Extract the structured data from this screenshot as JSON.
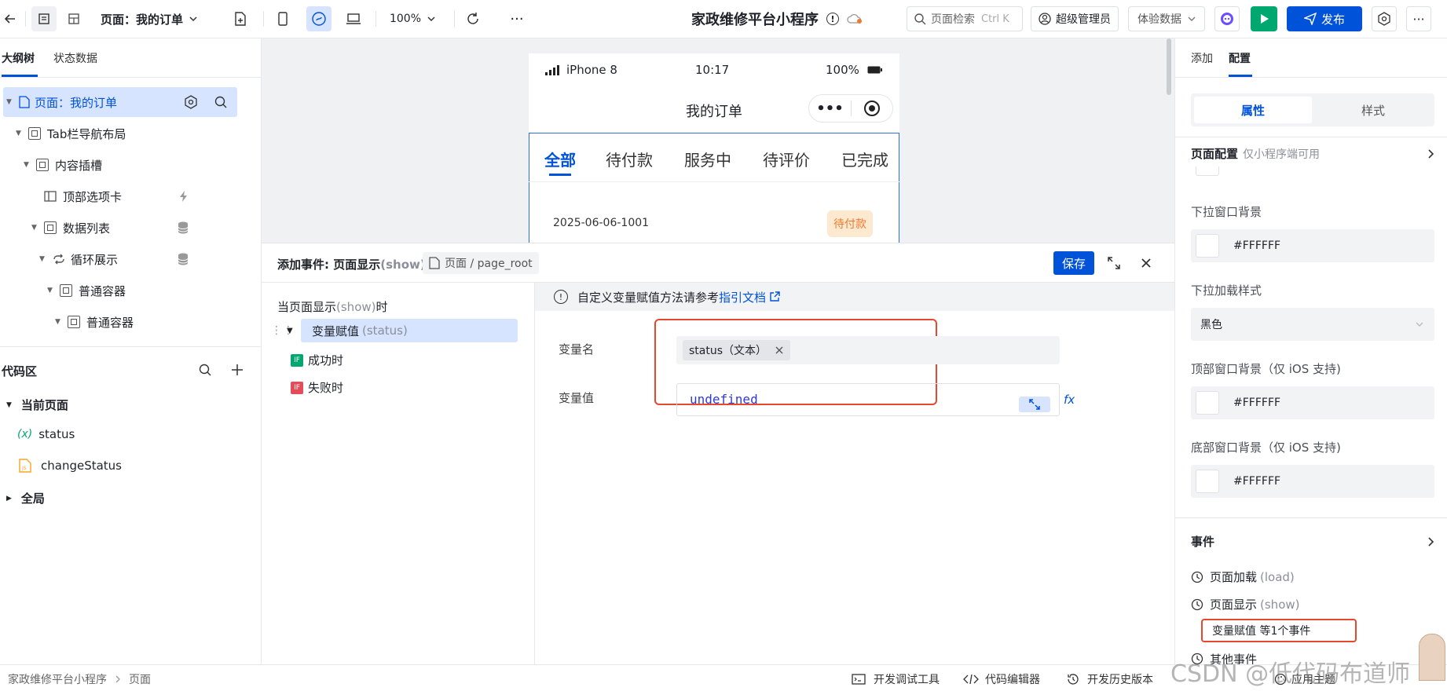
{
  "topbar": {
    "page_selector": "页面：我的订单",
    "zoom": "100%",
    "app_title": "家政维修平台小程序",
    "search_placeholder": "页面检索",
    "search_shortcut": "Ctrl K",
    "user": "超级管理员",
    "data_mode": "体验数据",
    "publish_label": "发布"
  },
  "left": {
    "tabs": [
      "大纲树",
      "状态数据"
    ],
    "tree": [
      {
        "label": "页面：我的订单"
      },
      {
        "label": "Tab栏导航布局"
      },
      {
        "label": "内容插槽"
      },
      {
        "label": "顶部选项卡"
      },
      {
        "label": "数据列表"
      },
      {
        "label": "循环展示"
      },
      {
        "label": "普通容器"
      },
      {
        "label": "普通容器"
      }
    ],
    "code_title": "代码区",
    "current_page": "当前页面",
    "code_items": [
      "status",
      "changeStatus"
    ],
    "var_icon_text": "(x)",
    "global": "全局"
  },
  "phone": {
    "carrier": "iPhone 8",
    "time": "10:17",
    "battery": "100%",
    "title": "我的订单",
    "tabs": [
      "全部",
      "待付款",
      "服务中",
      "待评价",
      "已完成"
    ],
    "order_no": "2025-06-06-1001",
    "order_status": "待付款"
  },
  "dialog": {
    "title": "添加事件: 页面显示",
    "title_sub": "(show)",
    "breadcrumb": "页面 / page_root",
    "save_label": "保存",
    "trigger_prefix": "当页面显示",
    "trigger_code": "(show)",
    "trigger_suffix": "时",
    "action_label": "变量赋值",
    "action_code": "(status)",
    "success_label": "成功时",
    "fail_label": "失败时",
    "if_badge": "IF",
    "tip_text": "自定义变量赋值方法请参考",
    "tip_link": "指引文档",
    "var_name_label": "变量名",
    "var_name_tag": "status（文本）",
    "var_value_label": "变量值",
    "var_value": "undefined",
    "fx_label": "fx"
  },
  "right": {
    "tabs": [
      "添加",
      "配置"
    ],
    "segment": [
      "属性",
      "样式"
    ],
    "page_config": "页面配置",
    "page_config_note": "仅小程序端可用",
    "pulldown_bg_label": "下拉窗口背景",
    "pulldown_bg_value": "#FFFFFF",
    "pulldown_style_label": "下拉加载样式",
    "pulldown_style_value": "黑色",
    "top_bg_label": "顶部窗口背景（仅 iOS 支持)",
    "top_bg_value": "#FFFFFF",
    "bottom_bg_label": "底部窗口背景（仅 iOS 支持)",
    "bottom_bg_value": "#FFFFFF",
    "events_title": "事件",
    "event_load": "页面加载",
    "event_load_code": "(load)",
    "event_show": "页面显示",
    "event_show_code": "(show)",
    "event_summary": "变量赋值 等1个事件",
    "event_more": "其他事件"
  },
  "bottom": {
    "breadcrumb_app": "家政维修平台小程序",
    "breadcrumb_page": "页面",
    "debug_tool": "开发调试工具",
    "code_editor": "代码编辑器",
    "history": "开发历史版本",
    "theme": "应用主题",
    "watermark": "CSDN @低代码布道师"
  },
  "colors": {
    "primary": "#0052d9",
    "tree_selected": "#d6e4ff",
    "highlight_red": "#e5482d",
    "success_green": "#00a870",
    "fail_red": "#e34d59",
    "status_orange": "#ed7b2f"
  }
}
